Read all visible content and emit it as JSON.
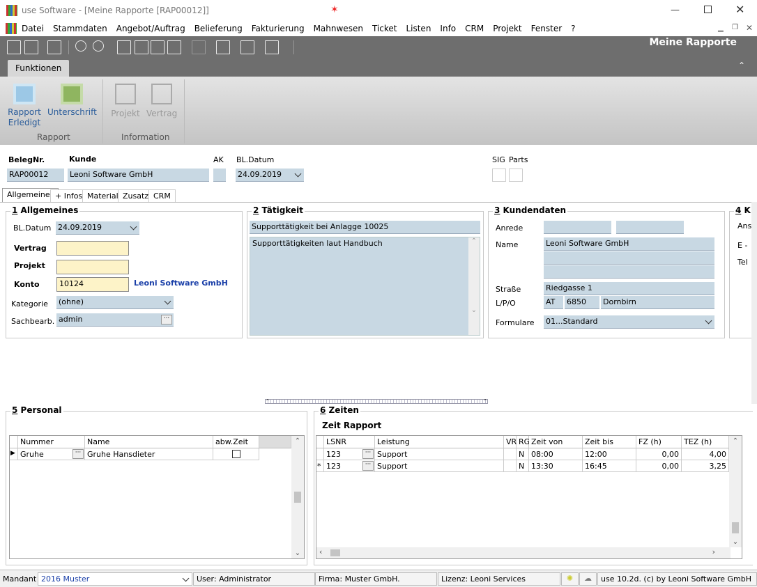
{
  "window": {
    "title": "use Software - [Meine Rapporte [RAP00012]]"
  },
  "menu": [
    "Datei",
    "Stammdaten",
    "Angebot/Auftrag",
    "Belieferung",
    "Fakturierung",
    "Mahnwesen",
    "Ticket",
    "Listen",
    "Info",
    "CRM",
    "Projekt",
    "Fenster",
    "?"
  ],
  "toolbar": {
    "caption": "Meine Rapporte"
  },
  "ribbon": {
    "tab": "Funktionen",
    "groups": [
      {
        "label": "Rapport",
        "buttons": [
          "Rapport\nErledigt",
          "Unterschrift"
        ]
      },
      {
        "label": "Information",
        "buttons": [
          "Projekt",
          "Vertrag"
        ]
      }
    ]
  },
  "header": {
    "belegnr_label": "BelegNr.",
    "belegnr": "RAP00012",
    "kunde_label": "Kunde",
    "kunde": "Leoni Software GmbH",
    "ak_label": "AK",
    "bldatum_label": "BL.Datum",
    "bldatum": "24.09.2019",
    "sig_label": "SIG",
    "parts_label": "Parts"
  },
  "tabs": [
    "Allgemeines",
    "+ Infos",
    "Material",
    "Zusatz",
    "CRM"
  ],
  "allgemeines": {
    "title_num": "1",
    "title": " Allgemeines",
    "bldatum_label": "BL.Datum",
    "bldatum": "24.09.2019",
    "vertrag_label": "Vertrag",
    "projekt_label": "Projekt",
    "konto_label": "Konto",
    "konto": "10124",
    "konto_name": "Leoni Software GmbH",
    "kategorie_label": "Kategorie",
    "kategorie": "(ohne)",
    "sachbearb_label": "Sachbearb.",
    "sachbearb": "admin"
  },
  "taetigkeit": {
    "title_num": "2",
    "title": " Tätigkeit",
    "subject": "Supporttätigkeit bei Anlagge 10025",
    "text": "Supporttätigkeiten laut Handbuch"
  },
  "kundendaten": {
    "title_num": "3",
    "title": " Kundendaten",
    "anrede_label": "Anrede",
    "name_label": "Name",
    "name": "Leoni Software GmbH",
    "strasse_label": "Straße",
    "strasse": "Riedgasse 1",
    "lpo_label": "L/P/O",
    "land": "AT",
    "plz": "6850",
    "ort": "Dornbirn",
    "formulare_label": "Formulare",
    "formulare": "01...Standard"
  },
  "group4": {
    "title_num": "4",
    "title": " K",
    "labels": [
      "Ans",
      "E -",
      "Tel"
    ]
  },
  "personal": {
    "title_num": "5",
    "title": " Personal",
    "columns": [
      "Nummer",
      "Name",
      "abw.Zeit"
    ],
    "rows": [
      {
        "nummer": "Gruhe",
        "name": "Gruhe Hansdieter"
      }
    ]
  },
  "zeiten": {
    "title_num": "6",
    "title": " Zeiten",
    "subtitle": "Zeit Rapport",
    "columns": [
      "LSNR",
      "Leistung",
      "VR",
      "RG",
      "Zeit von",
      "Zeit bis",
      "FZ (h)",
      "TEZ (h)"
    ],
    "rows": [
      {
        "marker": "",
        "lsnr": "123",
        "leistung": "Support",
        "vr": "",
        "rg": "N",
        "von": "08:00",
        "bis": "12:00",
        "fz": "0,00",
        "tez": "4,00"
      },
      {
        "marker": "*",
        "lsnr": "123",
        "leistung": "Support",
        "vr": "",
        "rg": "N",
        "von": "13:30",
        "bis": "16:45",
        "fz": "0,00",
        "tez": "3,25"
      }
    ]
  },
  "status": {
    "mandant_label": "Mandant",
    "mandant": "2016 Muster",
    "user": "User: Administrator",
    "firma": "Firma: Muster GmbH.",
    "lizenz": "Lizenz: Leoni Services",
    "version": "use 10.2d. (c) by Leoni Software GmbH"
  }
}
